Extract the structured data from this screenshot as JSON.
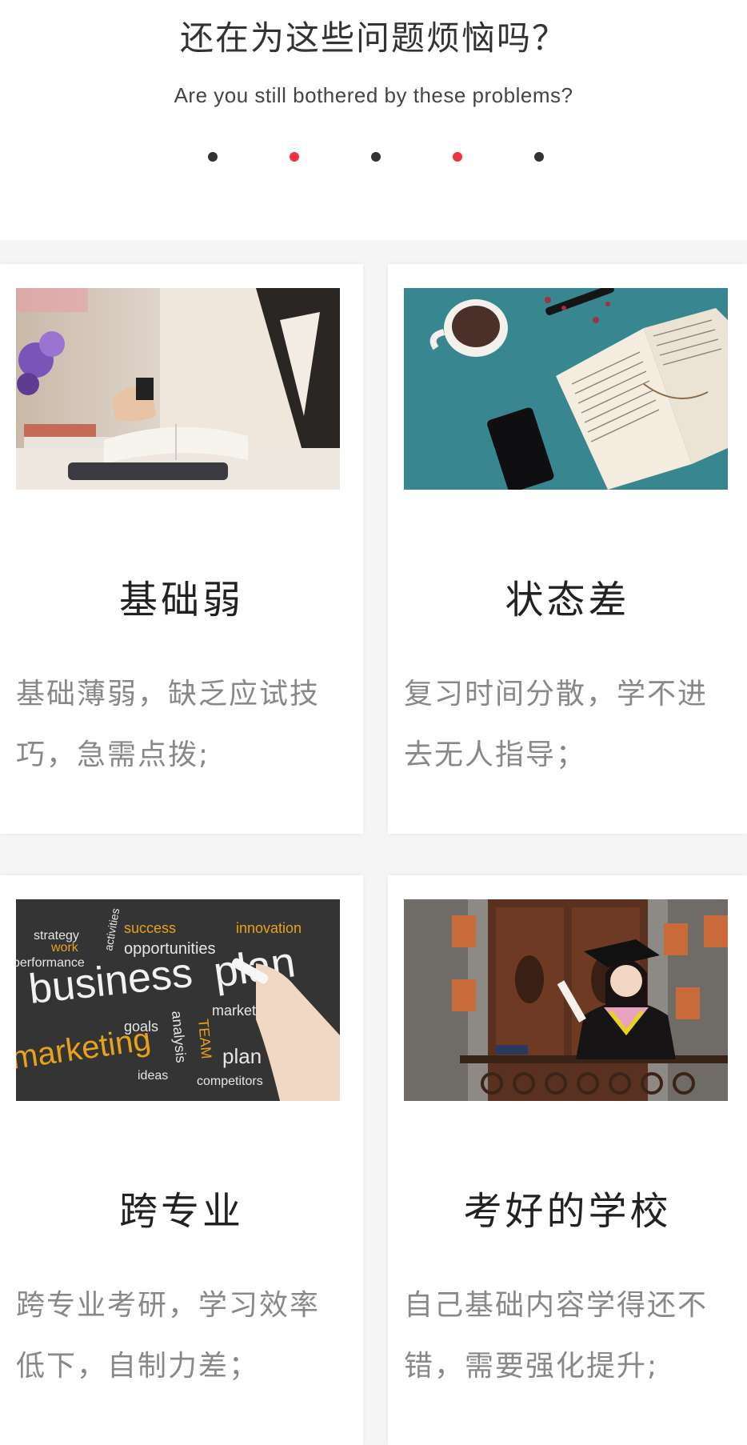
{
  "header": {
    "title": "还在为这些问题烦恼吗？",
    "subtitle": "Are you still bothered by these problems?",
    "dot_colors": [
      "#333333",
      "#f0333f",
      "#333333",
      "#f0333f",
      "#333333"
    ]
  },
  "cards": [
    {
      "title": "基础弱",
      "description": "基础薄弱，缺乏应试技巧，急需点拨;",
      "image": "student-reading-book-photo"
    },
    {
      "title": "状态差",
      "description": "复习时间分散，学不进去无人指导；",
      "image": "open-book-coffee-phone-photo"
    },
    {
      "title": "跨专业",
      "description": "跨专业考研，学习效率低下，自制力差；",
      "image": "business-plan-chalkboard-photo",
      "image_text": [
        "strategy",
        "success",
        "innovation",
        "work",
        "activities",
        "opportunities",
        "performance",
        "business",
        "plan",
        "goals",
        "market",
        "marketing",
        "analysis",
        "TEAM",
        "plan",
        "ideas",
        "competitors"
      ]
    },
    {
      "title": "考好的学校",
      "description": "自己基础内容学得还不错，需要强化提升;",
      "image": "graduate-in-gown-photo"
    }
  ],
  "colors": {
    "accent_red": "#f0333f",
    "title_text": "#333333",
    "desc_text": "#888888"
  }
}
